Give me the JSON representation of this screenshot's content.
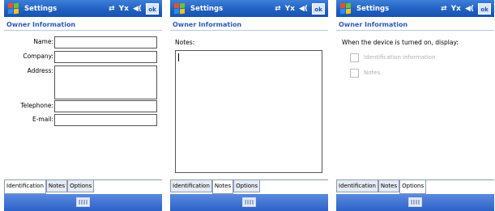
{
  "screens": [
    {
      "title": "Settings",
      "header": "Owner Information",
      "ok": "ok",
      "fields": [
        {
          "label": "Name:",
          "value": ""
        },
        {
          "label": "Company:",
          "value": ""
        },
        {
          "label": "Address:",
          "value": ""
        },
        {
          "label": "Telephone:",
          "value": ""
        },
        {
          "label": "E-mail:",
          "value": ""
        }
      ],
      "tabs": [
        "Identification",
        "Notes",
        "Options"
      ],
      "active_tab": "Identification"
    },
    {
      "title": "Settings",
      "header": "Owner Information",
      "ok": "ok",
      "notes_label": "Notes:",
      "notes_value": "",
      "tabs": [
        "Identification",
        "Notes",
        "Options"
      ],
      "active_tab": "Notes"
    },
    {
      "title": "Settings",
      "header": "Owner Information",
      "ok": "ok",
      "prompt": "When the device is turned on, display:",
      "options": [
        {
          "label": "Identification information",
          "checked": false
        },
        {
          "label": "Notes",
          "checked": false
        }
      ],
      "tabs": [
        "Identification",
        "Notes",
        "Options"
      ],
      "active_tab": "Options"
    }
  ],
  "icons": {
    "start": "windows-start-flag-icon",
    "connectivity": "connectivity-arrows-icon",
    "signal": "signal-off-icon",
    "volume": "speaker-icon",
    "keyboard": "keyboard-icon"
  },
  "colors": {
    "titlebar": "#1f5fc0",
    "header_text": "#2a5bb8",
    "bottombar": "#2d62c6"
  }
}
